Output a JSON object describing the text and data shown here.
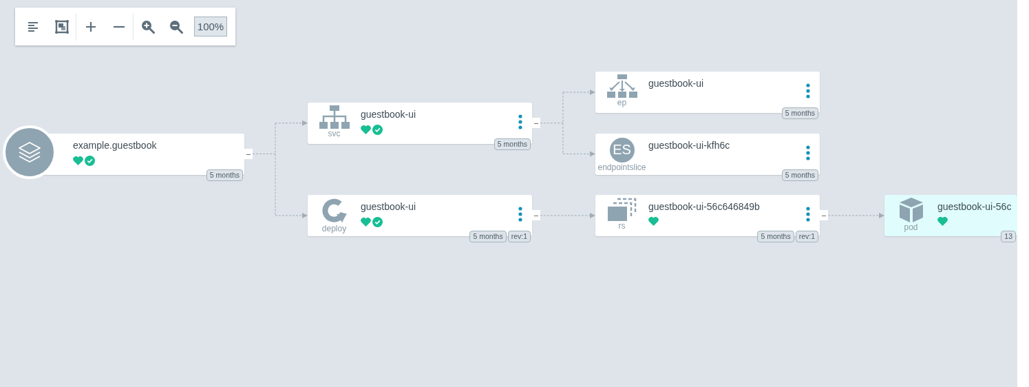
{
  "toolbar": {
    "buttons": [
      {
        "kind": "list"
      },
      {
        "kind": "fit"
      },
      {
        "kind": "plus"
      },
      {
        "kind": "minus"
      },
      {
        "kind": "zoom-in"
      },
      {
        "kind": "zoom-out"
      }
    ],
    "zoom_level": "100%"
  },
  "tree": {
    "kind": "application",
    "name": "example.guestbook",
    "healthy": true,
    "synced": true,
    "highlighted": false,
    "badges": [
      "5 months"
    ],
    "collapse": "–",
    "children": [
      {
        "kind": "svc",
        "type_label": "svc",
        "name": "guestbook-ui",
        "healthy": true,
        "synced": true,
        "highlighted": false,
        "badges": [
          "5 months"
        ],
        "collapse": "–",
        "children": [
          {
            "kind": "ep",
            "type_label": "ep",
            "name": "guestbook-ui",
            "healthy": false,
            "synced": false,
            "highlighted": false,
            "badges": [
              "5 months"
            ]
          },
          {
            "kind": "endpointslice",
            "type_label": "endpointslice",
            "icon_text": "ES",
            "name": "guestbook-ui-kfh6c",
            "healthy": false,
            "synced": false,
            "highlighted": false,
            "badges": [
              "5 months"
            ]
          }
        ]
      },
      {
        "kind": "deploy",
        "type_label": "deploy",
        "name": "guestbook-ui",
        "healthy": true,
        "synced": true,
        "highlighted": false,
        "badges": [
          "5 months",
          "rev:1"
        ],
        "collapse": "–",
        "children": [
          {
            "kind": "rs",
            "type_label": "rs",
            "name": "guestbook-ui-56c646849b",
            "healthy": true,
            "synced": false,
            "highlighted": false,
            "badges": [
              "5 months",
              "rev:1"
            ],
            "collapse": "–",
            "children": [
              {
                "kind": "pod",
                "type_label": "pod",
                "name": "guestbook-ui-56c",
                "healthy": true,
                "synced": false,
                "highlighted": true,
                "badges": [
                  "13"
                ]
              }
            ]
          }
        ]
      }
    ]
  }
}
